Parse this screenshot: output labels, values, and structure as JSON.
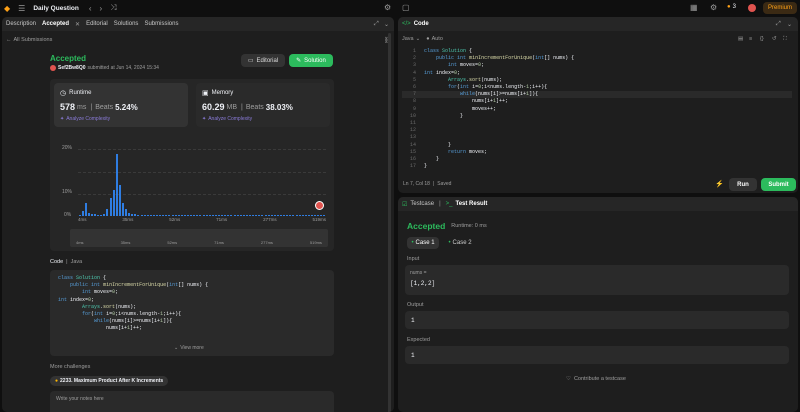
{
  "topbar": {
    "title": "Daily Question",
    "streak": "3",
    "premium": "Premium"
  },
  "left": {
    "tabs": [
      "Description",
      "Accepted",
      "Editorial",
      "Solutions",
      "Submissions"
    ],
    "back": "All Submissions",
    "status": "Accepted",
    "user": "Sef2Bw8Q0",
    "submitted": "submitted at Jun 14, 2024 15:34",
    "editorial_btn": "Editorial",
    "solution_btn": "Solution",
    "runtime": {
      "label": "Runtime",
      "value": "578",
      "unit": "ms",
      "beats_label": "Beats",
      "beats": "5.24%",
      "analyze": "Analyze Complexity"
    },
    "memory": {
      "label": "Memory",
      "value": "60.29",
      "unit": "MB",
      "beats_label": "Beats",
      "beats": "38.03%",
      "analyze": "Analyze Complexity"
    },
    "code_label": "Code",
    "lang": "Java",
    "code_lines": [
      "class Solution {",
      "    public int minIncrementForUnique(int[] nums) {",
      "        int moves=0;",
      "int index=0;",
      "        Arrays.sort(nums);",
      "        for(int i=0;i<nums.length-1;i++){",
      "            while(nums[i]>=nums[i+1]){",
      "                nums[i+1]++;"
    ],
    "view_more": "View more",
    "more_challenges": "More challenges",
    "challenge": "2233. Maximum Product After K Increments",
    "notes_placeholder": "Write your notes here"
  },
  "chart_data": {
    "type": "bar",
    "title": "",
    "xlabel": "",
    "ylabel": "",
    "y_ticks": [
      "20%",
      "10%",
      "0%"
    ],
    "x_ticks": [
      "4ms",
      "35ms",
      "52ms",
      "71ms",
      "277ms",
      "519ms"
    ],
    "ylim": [
      0,
      30
    ],
    "values": [
      0.5,
      2.5,
      6,
      1.5,
      1,
      0.8,
      0.6,
      0.5,
      1,
      3,
      8,
      12,
      28,
      14,
      6,
      3,
      1.5,
      1,
      0.8,
      0.6,
      0.5,
      0.4,
      0.4,
      0.3,
      0.3,
      0.3,
      0.3,
      0.3,
      0.3,
      0.3,
      0.3,
      0.3,
      0.3,
      0.3,
      0.3,
      0.3,
      0.3,
      0.3,
      0.3,
      0.3,
      0.3,
      0.3,
      0.3,
      0.3,
      0.3,
      0.3,
      0.3,
      0.3,
      0.3,
      0.3,
      0.3,
      0.3,
      0.3,
      0.3,
      0.3,
      0.3,
      0.3,
      0.3,
      0.3,
      0.3,
      0.3,
      0.3,
      0.3,
      0.3,
      0.3,
      0.3,
      0.3,
      0.3,
      0.3,
      0.3,
      0.3,
      0.3,
      0.3,
      0.3,
      0.3,
      0.3,
      0.3,
      0.3,
      0.3,
      0.3
    ],
    "grid": true
  },
  "editor": {
    "title": "Code",
    "lang": "Java",
    "auto": "Auto",
    "lines": [
      "class Solution {",
      "    public int minIncrementForUnique(int[] nums) {",
      "        int moves=0;",
      "int index=0;",
      "        Arrays.sort(nums);",
      "        for(int i=0;i<nums.length-1;i++){",
      "            while(nums[i]>=nums[i+1]){",
      "                nums[i+1]++;",
      "                moves++;",
      "            }",
      "",
      "",
      "",
      "        }",
      "        return moves;",
      "    }",
      "}"
    ],
    "status": "Ln 7, Col 18",
    "saved": "Saved",
    "run": "Run",
    "submit": "Submit"
  },
  "results": {
    "tab_testcase": "Testcase",
    "tab_result": "Test Result",
    "status": "Accepted",
    "runtime": "Runtime: 0 ms",
    "case1": "Case 1",
    "case2": "Case 2",
    "input_label": "Input",
    "input_var": "nums =",
    "input_val": "[1,2,2]",
    "output_label": "Output",
    "output_val": "1",
    "expected_label": "Expected",
    "expected_val": "1",
    "contribute": "Contribute a testcase"
  }
}
